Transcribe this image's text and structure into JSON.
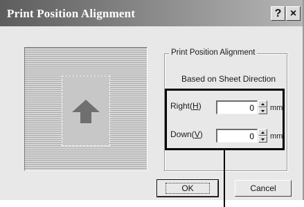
{
  "dialog": {
    "title": "Print Position Alignment",
    "help_glyph": "?",
    "close_glyph": "×"
  },
  "preview": {
    "sheet_arrow_icon": "up-arrow-icon"
  },
  "group": {
    "label": "Print Position Alignment",
    "subtitle": "Based on Sheet Direction",
    "right": {
      "label_main": "Right(",
      "label_key": "H",
      "label_end": ")",
      "value": "0",
      "unit": "mm"
    },
    "down": {
      "label_main": "Down(",
      "label_key": "V",
      "label_end": ")",
      "value": "0",
      "unit": "mm"
    }
  },
  "buttons": {
    "ok": "OK",
    "cancel": "Cancel"
  },
  "colors": {
    "title_gradient_left": "#5d5d5d",
    "face": "#e8e8e8",
    "highlight_box": "#000000"
  }
}
